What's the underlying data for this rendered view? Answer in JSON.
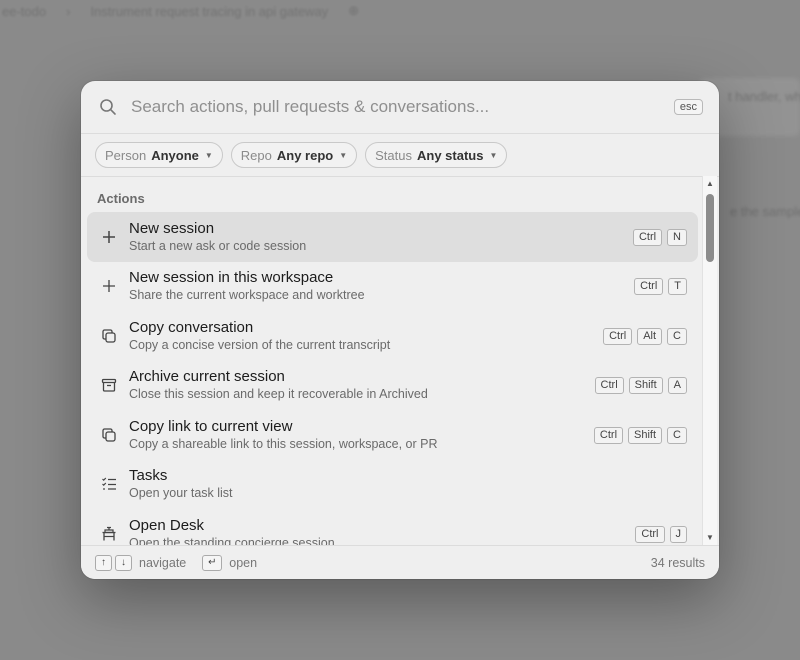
{
  "background": {
    "breadcrumb_1": "ee-todo",
    "breadcrumb_sep": "›",
    "breadcrumb_2": "Instrument request tracing in api gateway",
    "breadcrumb_action": "⊕",
    "snippet_1": "t handler, wh",
    "snippet_2": "e the sample"
  },
  "search": {
    "placeholder": "Search actions, pull requests & conversations...",
    "value": "",
    "esc_label": "esc"
  },
  "filters": [
    {
      "key": "Person",
      "value": "Anyone"
    },
    {
      "key": "Repo",
      "value": "Any repo"
    },
    {
      "key": "Status",
      "value": "Any status"
    }
  ],
  "section_label": "Actions",
  "items": [
    {
      "icon": "plus-icon",
      "title": "New session",
      "subtitle": "Start a new ask or code session",
      "keys": [
        "Ctrl",
        "N"
      ],
      "active": true
    },
    {
      "icon": "plus-icon",
      "title": "New session in this workspace",
      "subtitle": "Share the current workspace and worktree",
      "keys": [
        "Ctrl",
        "T"
      ],
      "active": false
    },
    {
      "icon": "copy-icon",
      "title": "Copy conversation",
      "subtitle": "Copy a concise version of the current transcript",
      "keys": [
        "Ctrl",
        "Alt",
        "C"
      ],
      "active": false
    },
    {
      "icon": "archive-icon",
      "title": "Archive current session",
      "subtitle": "Close this session and keep it recoverable in Archived",
      "keys": [
        "Ctrl",
        "Shift",
        "A"
      ],
      "active": false
    },
    {
      "icon": "copy-link-icon",
      "title": "Copy link to current view",
      "subtitle": "Copy a shareable link to this session, workspace, or PR",
      "keys": [
        "Ctrl",
        "Shift",
        "C"
      ],
      "active": false
    },
    {
      "icon": "tasks-icon",
      "title": "Tasks",
      "subtitle": "Open your task list",
      "keys": [],
      "active": false
    },
    {
      "icon": "desk-icon",
      "title": "Open Desk",
      "subtitle": "Open the standing concierge session",
      "keys": [
        "Ctrl",
        "J"
      ],
      "active": false
    }
  ],
  "footer": {
    "navigate_label": "navigate",
    "open_label": "open",
    "results": "34 results"
  }
}
